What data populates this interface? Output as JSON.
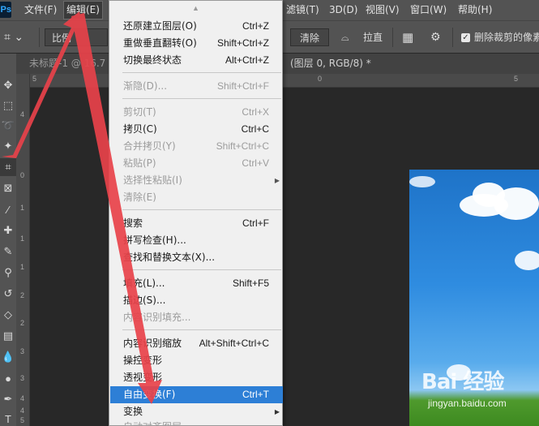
{
  "app": {
    "logo": "Ps"
  },
  "menubar": {
    "items": [
      {
        "label": "文件(F)",
        "name": "menu-file"
      },
      {
        "label": "编辑(E)",
        "name": "menu-edit"
      },
      {
        "label": "滤镜(T)",
        "name": "menu-filter"
      },
      {
        "label": "3D(D)",
        "name": "menu-3d"
      },
      {
        "label": "视图(V)",
        "name": "menu-view"
      },
      {
        "label": "窗口(W)",
        "name": "menu-window"
      },
      {
        "label": "帮助(H)",
        "name": "menu-help"
      }
    ]
  },
  "options": {
    "ratio_label": "比例",
    "clear_label": "清除",
    "straighten_label": "拉直",
    "delete_cropped_label": "删除裁剪的像素"
  },
  "tabs": {
    "doc1": "未标题-1 @ 16.7",
    "doc2": "(图层 0, RGB/8) *"
  },
  "rulers": {
    "top": [
      "5",
      "0",
      "5"
    ],
    "left": [
      "4",
      "0",
      "1",
      "1",
      "1",
      "2",
      "2",
      "3",
      "3",
      "4",
      "4",
      "5"
    ]
  },
  "edit_menu": {
    "items": [
      {
        "label": "还原建立图层(O)",
        "shortcut": "Ctrl+Z",
        "state": "enabled"
      },
      {
        "label": "重做垂直翻转(O)",
        "shortcut": "Shift+Ctrl+Z",
        "state": "enabled"
      },
      {
        "label": "切换最终状态",
        "shortcut": "Alt+Ctrl+Z",
        "state": "enabled"
      },
      {
        "label": "渐隐(D)...",
        "shortcut": "Shift+Ctrl+F",
        "state": "disabled"
      },
      {
        "label": "剪切(T)",
        "shortcut": "Ctrl+X",
        "state": "disabled"
      },
      {
        "label": "拷贝(C)",
        "shortcut": "Ctrl+C",
        "state": "enabled"
      },
      {
        "label": "合并拷贝(Y)",
        "shortcut": "Shift+Ctrl+C",
        "state": "disabled"
      },
      {
        "label": "粘贴(P)",
        "shortcut": "Ctrl+V",
        "state": "disabled"
      },
      {
        "label": "选择性粘贴(I)",
        "shortcut": "",
        "state": "disabled"
      },
      {
        "label": "清除(E)",
        "shortcut": "",
        "state": "disabled"
      },
      {
        "label": "搜索",
        "shortcut": "Ctrl+F",
        "state": "enabled"
      },
      {
        "label": "拼写检查(H)...",
        "shortcut": "",
        "state": "enabled"
      },
      {
        "label": "查找和替换文本(X)...",
        "shortcut": "",
        "state": "enabled"
      },
      {
        "label": "填充(L)...",
        "shortcut": "Shift+F5",
        "state": "enabled"
      },
      {
        "label": "描边(S)...",
        "shortcut": "",
        "state": "enabled"
      },
      {
        "label": "内容识别填充...",
        "shortcut": "",
        "state": "disabled"
      },
      {
        "label": "内容识别缩放",
        "shortcut": "Alt+Shift+Ctrl+C",
        "state": "enabled"
      },
      {
        "label": "操控变形",
        "shortcut": "",
        "state": "enabled"
      },
      {
        "label": "透视变形",
        "shortcut": "",
        "state": "enabled"
      },
      {
        "label": "自由变换(F)",
        "shortcut": "Ctrl+T",
        "state": "highlighted"
      },
      {
        "label": "变换",
        "shortcut": "",
        "state": "enabled"
      },
      {
        "label": "自动对齐图层...",
        "shortcut": "",
        "state": "disabled"
      }
    ]
  },
  "watermark": {
    "logo": "Bai 经验",
    "url": "jingyan.baidu.com"
  },
  "colors": {
    "menubar_bg": "#535353",
    "menu_bg": "#f0f0f0",
    "highlight": "#2d7fd6",
    "arrow": "#e8424a"
  }
}
